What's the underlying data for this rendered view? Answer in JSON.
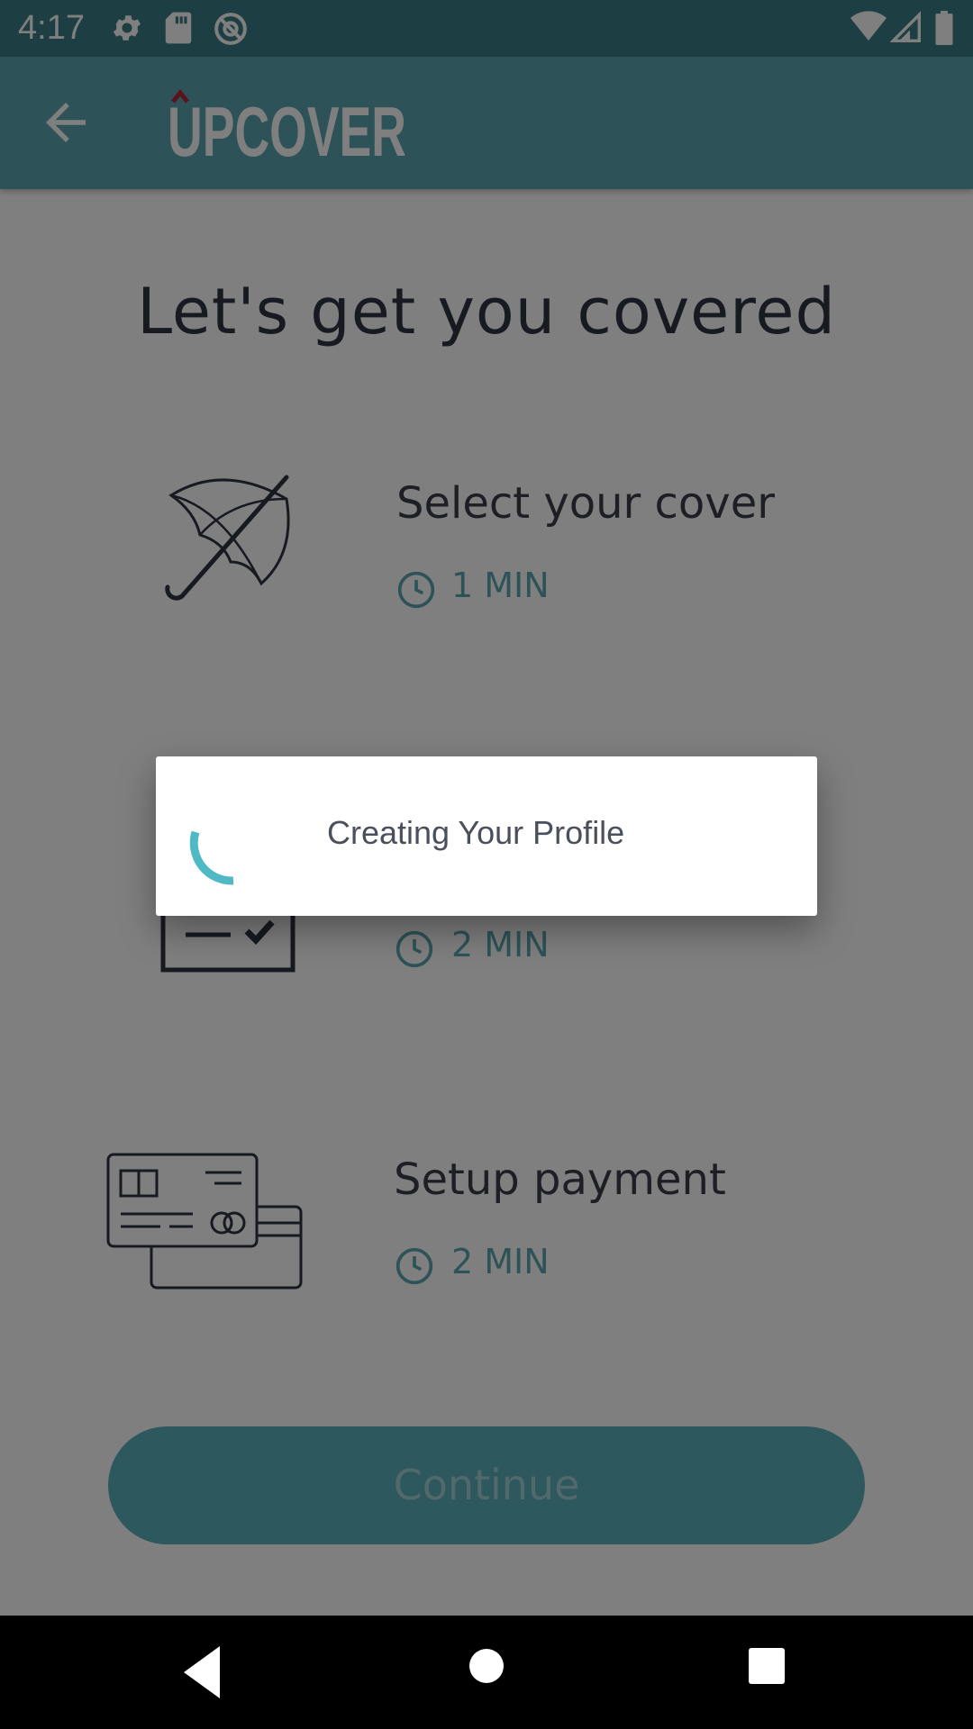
{
  "status_bar": {
    "time": "4:17",
    "icons": [
      "settings-icon",
      "sd-card-icon",
      "at-sign-icon",
      "wifi-icon",
      "signal-icon",
      "battery-icon"
    ]
  },
  "app_bar": {
    "back_icon": "arrow-back-icon",
    "logo_text": "UPCOVER"
  },
  "main": {
    "title": "Let's get you covered",
    "steps": [
      {
        "title": "Select your cover",
        "time": "1 MIN",
        "icon": "umbrella-icon"
      },
      {
        "title": "",
        "time": "2 MIN",
        "icon": "checkbox-form-icon"
      },
      {
        "title": "Setup payment",
        "time": "2 MIN",
        "icon": "credit-card-icon"
      }
    ],
    "continue_label": "Continue"
  },
  "dialog": {
    "message": "Creating Your Profile"
  },
  "nav_bar": {
    "icons": [
      "back-triangle-icon",
      "home-circle-icon",
      "recents-square-icon"
    ]
  },
  "colors": {
    "accent": "#5aa6b0",
    "text_dark": "#2f3542",
    "spinner": "#4fbac6",
    "logo_caret": "#b5253a"
  }
}
